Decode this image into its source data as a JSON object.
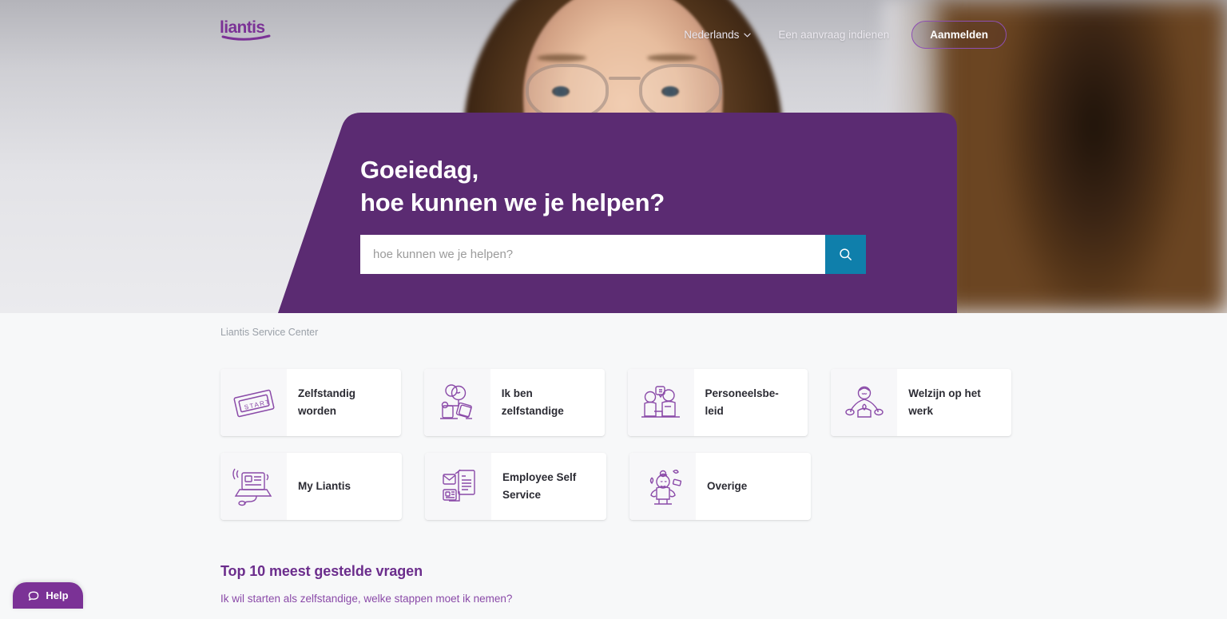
{
  "header": {
    "logo_text": "liantis",
    "language": "Nederlands",
    "request_link": "Een aanvraag indienen",
    "login_button": "Aanmelden"
  },
  "hero": {
    "title": "Goeiedag,\nhoe kunnen we je helpen?",
    "search_placeholder": "hoe kunnen we je helpen?",
    "search_value": "",
    "panel_color": "#5b2b72",
    "search_button_color": "#0f7fab"
  },
  "breadcrumb": {
    "label": "Liantis Service Center"
  },
  "cards": [
    {
      "label": "Zelfstandig worden",
      "icon": "start-ticket-icon"
    },
    {
      "label": "Ik ben zelfstandige",
      "icon": "self-employed-person-icon"
    },
    {
      "label": "Personeelsbe-leid",
      "icon": "hr-people-icon"
    },
    {
      "label": "Welzijn op het werk",
      "icon": "wellbeing-meditation-icon"
    },
    {
      "label": "My Liantis",
      "icon": "laptop-icon"
    },
    {
      "label": "Employee Self Service",
      "icon": "documents-mail-icon"
    },
    {
      "label": "Overige",
      "icon": "juggling-person-icon"
    }
  ],
  "faq": {
    "title": "Top 10 meest gestelde vragen",
    "items": [
      "Ik wil starten als zelfstandige, welke stappen moet ik nemen?"
    ]
  },
  "help_widget": {
    "label": "Help"
  }
}
